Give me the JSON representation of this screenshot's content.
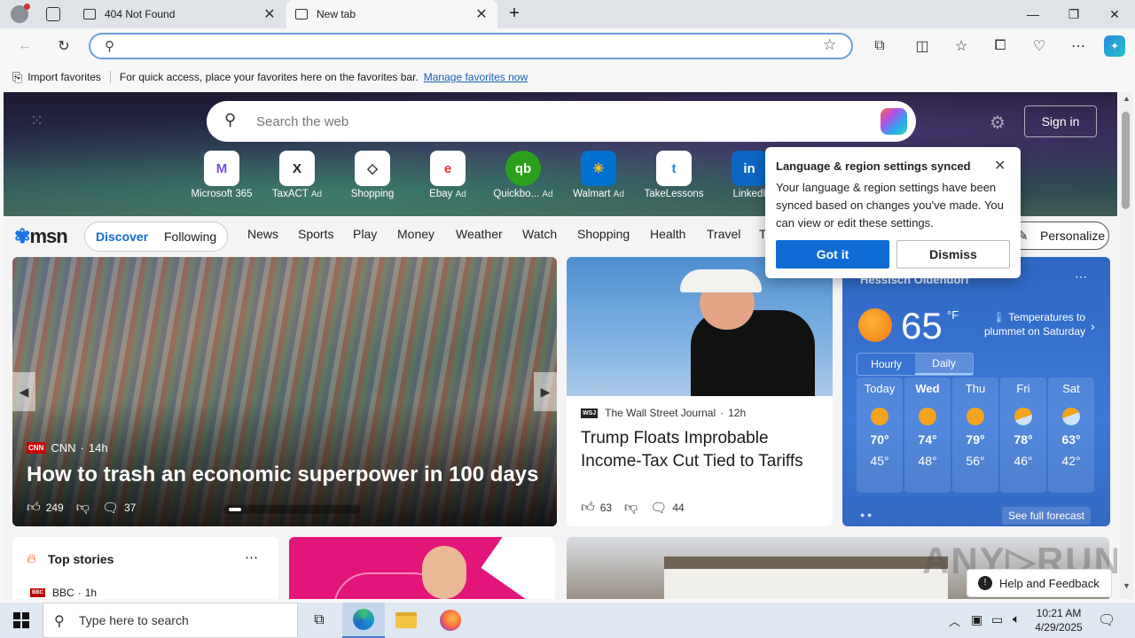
{
  "tabs": [
    {
      "title": "404 Not Found",
      "active": false
    },
    {
      "title": "New tab",
      "active": true
    }
  ],
  "address": {
    "placeholder": ""
  },
  "favorites_bar": {
    "import_label": "Import favorites",
    "message": "For quick access, place your favorites here on the favorites bar.",
    "manage_link": "Manage favorites now"
  },
  "newtab": {
    "search_placeholder": "Search the web",
    "sign_in": "Sign in",
    "quick_links": [
      {
        "label": "Microsoft 365",
        "ad": "",
        "icon": "M"
      },
      {
        "label": "TaxACT",
        "ad": "Ad",
        "icon": "X"
      },
      {
        "label": "Shopping",
        "ad": "",
        "icon": "◇"
      },
      {
        "label": "Ebay",
        "ad": "Ad",
        "icon": "e"
      },
      {
        "label": "Quickbo...",
        "ad": "Ad",
        "icon": "qb"
      },
      {
        "label": "Walmart",
        "ad": "Ad",
        "icon": "✳"
      },
      {
        "label": "TakeLessons",
        "ad": "",
        "icon": "t"
      },
      {
        "label": "LinkedI",
        "ad": "",
        "icon": "in"
      }
    ]
  },
  "msn_nav": {
    "logo": "msn",
    "discover": "Discover",
    "following": "Following",
    "items": [
      "News",
      "Sports",
      "Play",
      "Money",
      "Weather",
      "Watch",
      "Shopping",
      "Health",
      "Travel",
      "T"
    ],
    "personalize": "Personalize"
  },
  "hero_story": {
    "source": "CNN",
    "age": "14h",
    "headline": "How to trash an economic superpower in 100 days",
    "likes": "249",
    "comments": "37"
  },
  "side_story": {
    "source": "The Wall Street Journal",
    "age": "12h",
    "headline": "Trump Floats Improbable Income-Tax Cut Tied to Tariffs",
    "likes": "63",
    "comments": "44"
  },
  "weather": {
    "location": "Hessisch Oldendorf",
    "temp": "65",
    "unit": "°F",
    "alert": "Temperatures to plummet on Saturday",
    "tab_hourly": "Hourly",
    "tab_daily": "Daily",
    "days": [
      {
        "day": "Today",
        "high": "70°",
        "low": "45°",
        "icon": "sun"
      },
      {
        "day": "Wed",
        "high": "74°",
        "low": "48°",
        "icon": "sun"
      },
      {
        "day": "Thu",
        "high": "79°",
        "low": "56°",
        "icon": "sun"
      },
      {
        "day": "Fri",
        "high": "78°",
        "low": "46°",
        "icon": "partly-cloudy"
      },
      {
        "day": "Sat",
        "high": "63°",
        "low": "42°",
        "icon": "partly-cloudy"
      }
    ],
    "see_full": "See full forecast"
  },
  "top_stories": {
    "title": "Top stories",
    "source": "BBC",
    "age": "1h"
  },
  "popup": {
    "title": "Language & region settings synced",
    "body": "Your language & region settings have been synced based on changes you've made. You can view or edit these settings.",
    "primary": "Got it",
    "secondary": "Dismiss"
  },
  "help_feedback": "Help and Feedback",
  "watermark": "ANY RUN",
  "taskbar": {
    "search_placeholder": "Type here to search",
    "time": "10:21 AM",
    "date": "4/29/2025"
  },
  "colors": {
    "accent": "#0f6cd5",
    "weather_bg": "#3a74d2"
  }
}
